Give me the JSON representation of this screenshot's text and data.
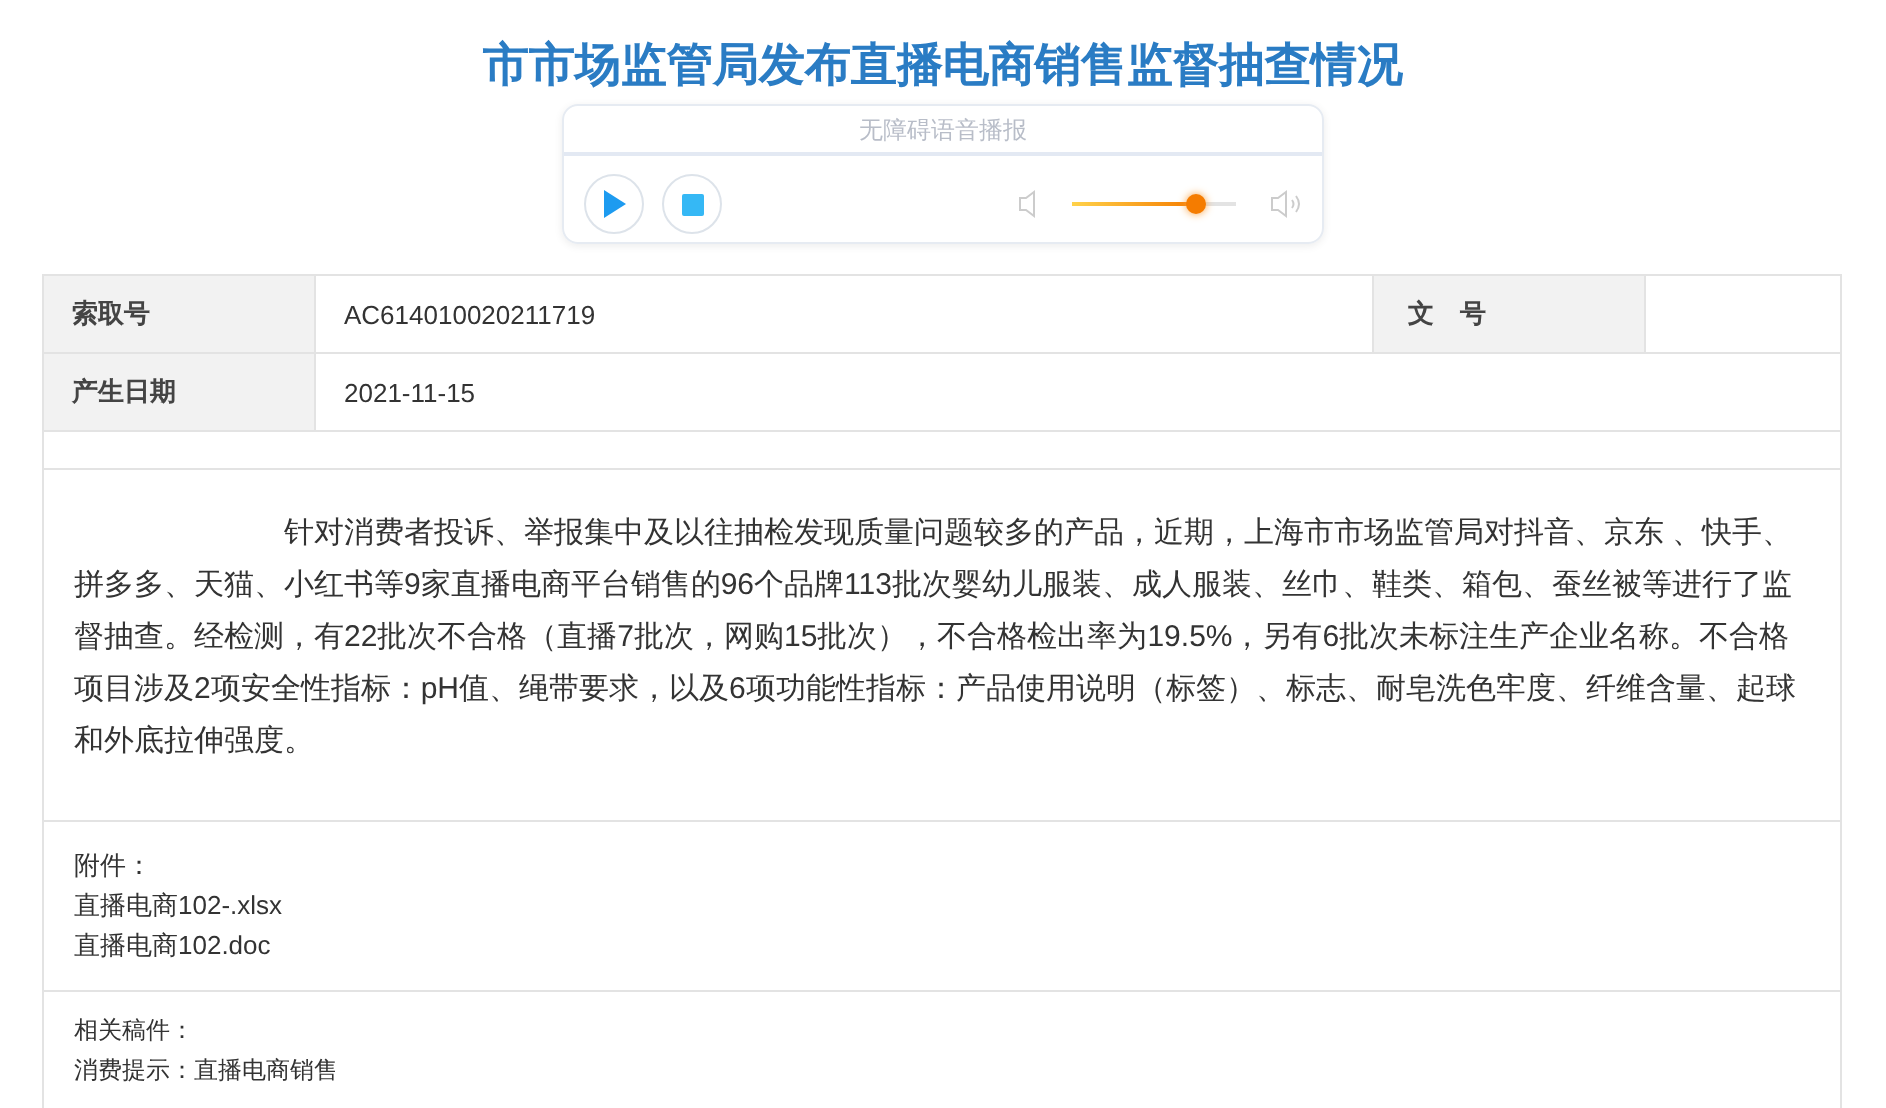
{
  "title": "市市场监管局发布直播电商销售监督抽查情况",
  "player": {
    "header": "无障碍语音播报",
    "playing": false,
    "level": 0.76
  },
  "info": [
    {
      "label": "索取号",
      "value": "AC614010020211719",
      "label_2": "文　号"
    },
    {
      "label": "产生日期",
      "value": "2021-11-15"
    }
  ],
  "body": "针对消费者投诉、举报集中及以往抽检发现质量问题较多的产品，近期，上海市市场监管局对抖音、京东 、快手、拼多多、天猫、小红书等9家直播电商平台销售的96个品牌113批次婴幼儿服装、成人服装、丝巾、鞋类、箱包、蚕丝被等进行了监督抽查。经检测，有22批次不合格（直播7批次，网购15批次），不合格检出率为19.5%，另有6批次未标注生产企业名称。不合格项目涉及2项安全性指标：pH值、绳带要求，以及6项功能性指标：产品使用说明（标签）、标志、耐皂洗色牢度、纤维含量、起球和外底拉伸强度。",
  "attachments": {
    "label": "附件：",
    "files": [
      "直播电商102-.xlsx",
      "直播电商102.doc"
    ]
  },
  "related": {
    "label": "相关稿件：",
    "tip": "消费提示：直播电商销售"
  }
}
